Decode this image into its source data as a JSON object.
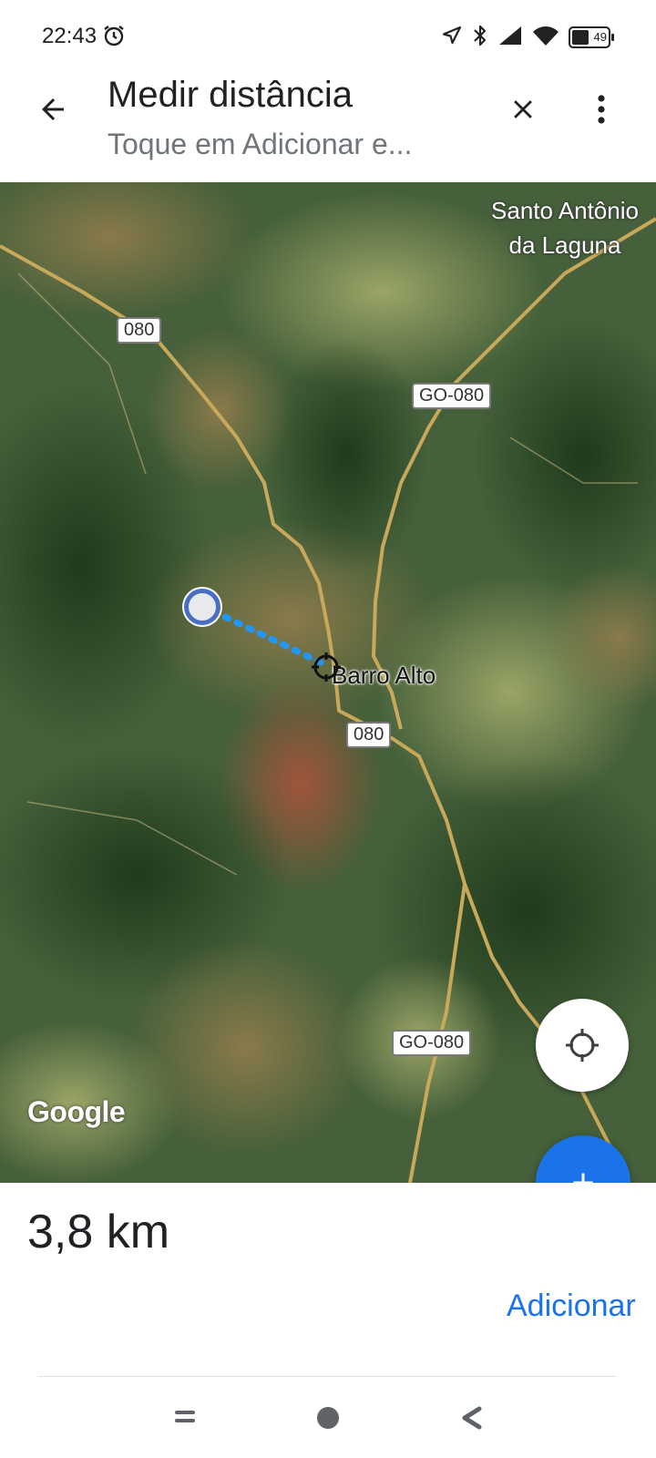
{
  "status_bar": {
    "time": "22:43",
    "battery": "49",
    "icons": [
      "alarm-icon",
      "location-arrow-icon",
      "bluetooth-icon",
      "cellular-signal-icon",
      "wifi-icon",
      "battery-icon"
    ]
  },
  "header": {
    "title": "Medir distância",
    "subtitle": "Toque em Adicionar e...",
    "icons": [
      "arrow-back-icon",
      "close-icon",
      "more-vert-icon"
    ]
  },
  "map": {
    "places": {
      "santo_antonio_line1": "Santo Antônio",
      "santo_antonio_line2": "da Laguna",
      "barro_alto": "Barro Alto"
    },
    "roads": {
      "r080_top": "080",
      "go080_upper": "GO-080",
      "r080_mid": "080",
      "go080_lower": "GO-080"
    },
    "attribution": "Google",
    "colors": {
      "measure_line": "#2196f3",
      "road": "#c8a85a"
    }
  },
  "measurement": {
    "distance": "3,8 km",
    "add_label": "Adicionar"
  },
  "colors": {
    "accent": "#1a73e8"
  }
}
